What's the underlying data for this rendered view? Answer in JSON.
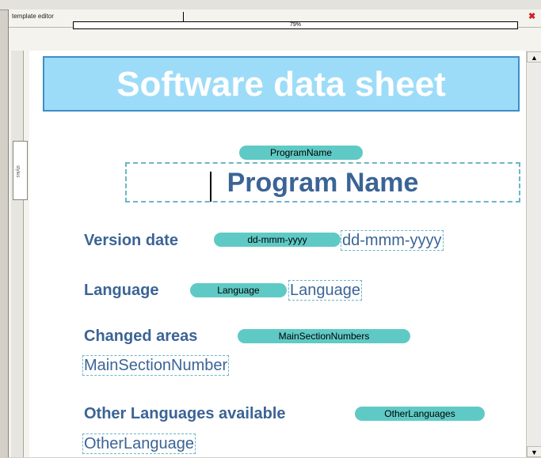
{
  "panel": {
    "title": "template editor",
    "ruler_label": "79%"
  },
  "side_tab": {
    "label": "styles"
  },
  "document": {
    "banner_title": "Software data sheet",
    "program_name_tag": "ProgramName",
    "program_name": "Program Name",
    "fields": [
      {
        "label": "Version date",
        "tag": "dd-mmm-yyyy",
        "value": "dd-mmm-yyyy"
      },
      {
        "label": "Language",
        "tag": "Language",
        "value": "Language"
      },
      {
        "label": "Changed areas",
        "tag": "MainSectionNumbers",
        "value": "MainSectionNumber"
      },
      {
        "label": "Other Languages available",
        "tag": "OtherLanguages",
        "value": "OtherLanguage"
      }
    ]
  },
  "colors": {
    "banner_bg": "#9ddcf8",
    "banner_border": "#3d8ec9",
    "tag_bg": "#5fcac5",
    "text_blue": "#3b6495",
    "dash": "#6ab6c8"
  }
}
